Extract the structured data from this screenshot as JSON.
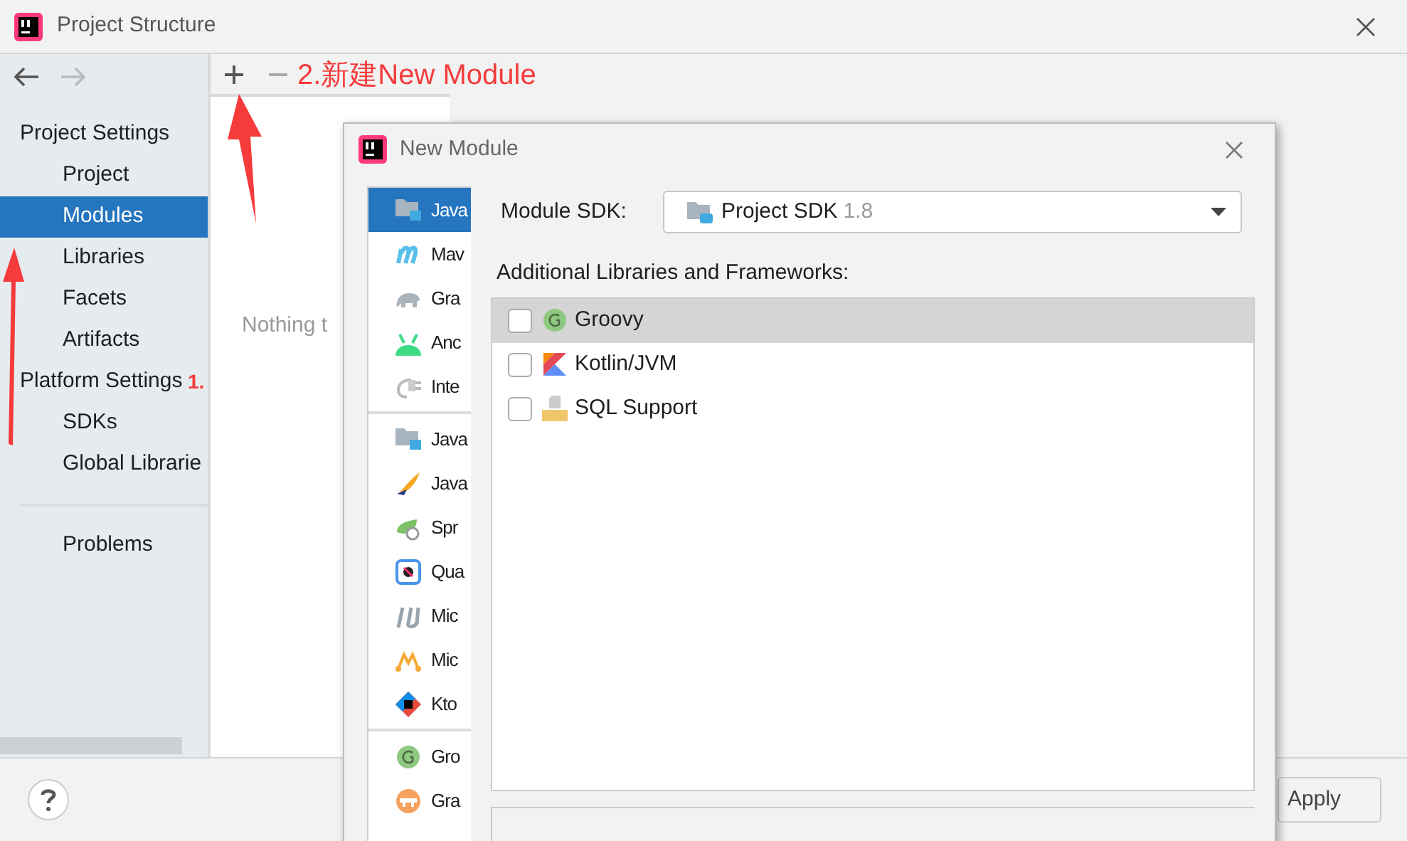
{
  "window": {
    "title": "Project Structure"
  },
  "sidebar": {
    "sections": [
      {
        "heading": "Project Settings",
        "items": [
          {
            "label": "Project",
            "selected": false
          },
          {
            "label": "Modules",
            "selected": true
          },
          {
            "label": "Libraries",
            "selected": false
          },
          {
            "label": "Facets",
            "selected": false
          },
          {
            "label": "Artifacts",
            "selected": false
          }
        ]
      },
      {
        "heading": "Platform Settings",
        "items": [
          {
            "label": "SDKs",
            "selected": false
          },
          {
            "label": "Global Librarie",
            "selected": false
          }
        ]
      }
    ],
    "extra_items": [
      {
        "label": "Problems",
        "selected": false
      }
    ]
  },
  "middle_panel": {
    "empty_text": "Nothing t"
  },
  "footer": {
    "buttons": [
      "Apply"
    ]
  },
  "dialog": {
    "title": "New Module",
    "module_types": [
      [
        {
          "label": "Java",
          "selected": true
        },
        {
          "label": "Mav",
          "selected": false
        },
        {
          "label": "Gra",
          "selected": false
        },
        {
          "label": "Anc",
          "selected": false
        },
        {
          "label": "Inte",
          "selected": false
        }
      ],
      [
        {
          "label": "Java",
          "selected": false
        },
        {
          "label": "Java",
          "selected": false
        },
        {
          "label": "Spr",
          "selected": false
        },
        {
          "label": "Qua",
          "selected": false
        },
        {
          "label": "Mic",
          "selected": false
        },
        {
          "label": "Mic",
          "selected": false
        },
        {
          "label": "Kto",
          "selected": false
        }
      ],
      [
        {
          "label": "Gro",
          "selected": false
        },
        {
          "label": "Gra",
          "selected": false
        }
      ]
    ],
    "sdk_label": "Module SDK:",
    "sdk_value": "Project SDK",
    "sdk_version": "1.8",
    "libraries_label": "Additional Libraries and Frameworks:",
    "libraries": [
      {
        "label": "Groovy",
        "checked": false,
        "selected": true
      },
      {
        "label": "Kotlin/JVM",
        "checked": false,
        "selected": false
      },
      {
        "label": "SQL Support",
        "checked": false,
        "selected": false
      }
    ]
  },
  "annotations": [
    {
      "text": "2.新建New Module"
    },
    {
      "text": "1."
    }
  ]
}
